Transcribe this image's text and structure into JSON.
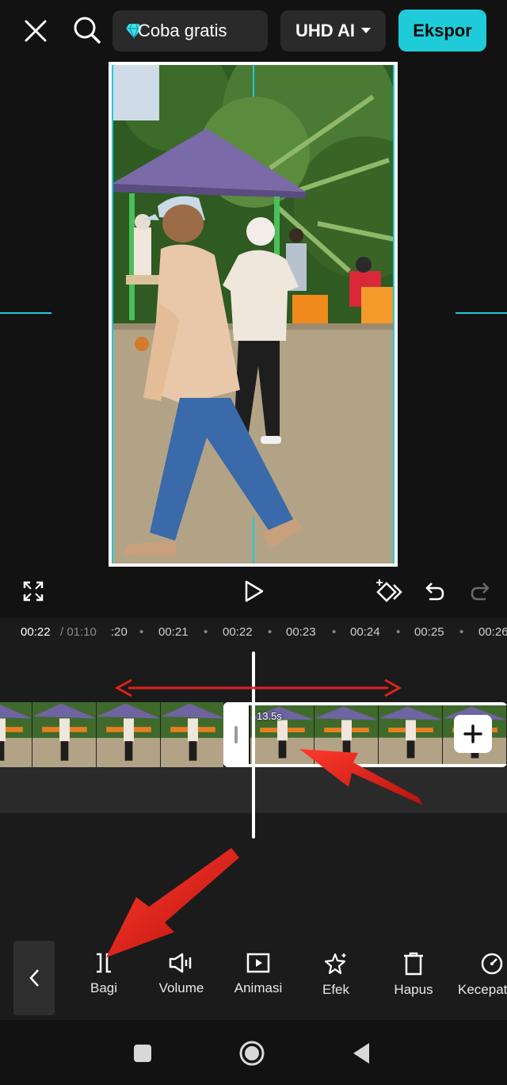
{
  "topbar": {
    "trial_label": "Coba gratis",
    "quality_label": "UHD AI",
    "export_label": "Ekspor"
  },
  "timeline": {
    "current_time": "00:22",
    "total_time": "/ 01:10",
    "ticks": [
      ":20",
      "00:21",
      "00:22",
      "00:23",
      "00:24",
      "00:25",
      "00:26"
    ],
    "clip_duration": "13.5s"
  },
  "toolbar": {
    "items": [
      {
        "label": "Bagi",
        "icon": "split-icon"
      },
      {
        "label": "Volume",
        "icon": "volume-icon"
      },
      {
        "label": "Animasi",
        "icon": "animation-icon"
      },
      {
        "label": "Efek",
        "icon": "effects-icon"
      },
      {
        "label": "Hapus",
        "icon": "delete-icon"
      },
      {
        "label": "Kecepatan",
        "icon": "speed-icon"
      }
    ]
  },
  "colors": {
    "accent": "#1fcbd8",
    "background": "#121212",
    "panel": "#1b1b1b",
    "annotation": "#e0201b"
  }
}
